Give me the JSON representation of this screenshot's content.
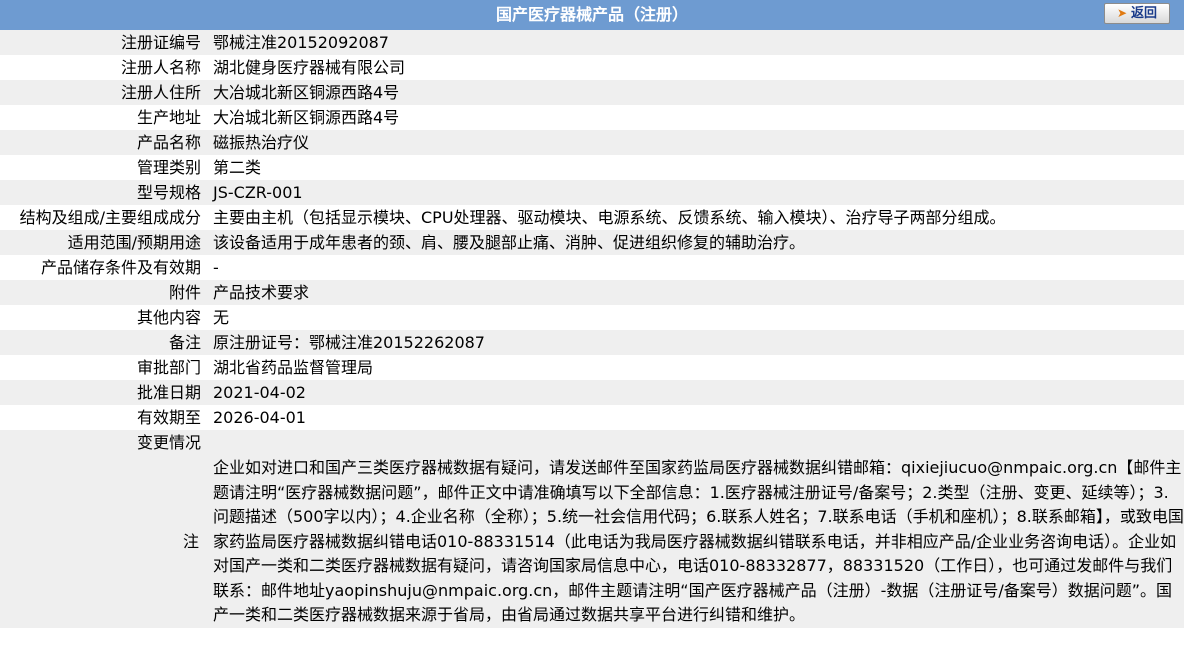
{
  "header": {
    "title": "国产医疗器械产品（注册）",
    "back_label": "返回"
  },
  "rows": [
    {
      "label": "注册证编号",
      "value": "鄂械注准20152092087"
    },
    {
      "label": "注册人名称",
      "value": "湖北健身医疗器械有限公司"
    },
    {
      "label": "注册人住所",
      "value": "大冶城北新区铜源西路4号"
    },
    {
      "label": "生产地址",
      "value": "大冶城北新区铜源西路4号"
    },
    {
      "label": "产品名称",
      "value": "磁振热治疗仪"
    },
    {
      "label": "管理类别",
      "value": "第二类"
    },
    {
      "label": "型号规格",
      "value": "JS-CZR-001"
    },
    {
      "label": "结构及组成/主要组成成分",
      "value": "主要由主机（包括显示模块、CPU处理器、驱动模块、电源系统、反馈系统、输入模块）、治疗导子两部分组成。"
    },
    {
      "label": "适用范围/预期用途",
      "value": "该设备适用于成年患者的颈、肩、腰及腿部止痛、消肿、促进组织修复的辅助治疗。"
    },
    {
      "label": "产品储存条件及有效期",
      "value": "-"
    },
    {
      "label": "附件",
      "value": "产品技术要求"
    },
    {
      "label": "其他内容",
      "value": "无"
    },
    {
      "label": "备注",
      "value": "原注册证号：鄂械注准20152262087"
    },
    {
      "label": "审批部门",
      "value": "湖北省药品监督管理局"
    },
    {
      "label": "批准日期",
      "value": "2021-04-02"
    },
    {
      "label": "有效期至",
      "value": "2026-04-01"
    },
    {
      "label": "变更情况",
      "value": ""
    }
  ],
  "note": {
    "label": "注",
    "text": "企业如对进口和国产三类医疗器械数据有疑问，请发送邮件至国家药监局医疗器械数据纠错邮箱：qixiejiucuo@nmpaic.org.cn【邮件主题请注明“医疗器械数据问题”，邮件正文中请准确填写以下全部信息：1.医疗器械注册证号/备案号；2.类型（注册、变更、延续等）；3.问题描述（500字以内）；4.企业名称（全称）；5.统一社会信用代码；6.联系人姓名；7.联系电话（手机和座机）；8.联系邮箱】，或致电国家药监局医疗器械数据纠错电话010-88331514（此电话为我局医疗器械数据纠错联系电话，并非相应产品/企业业务咨询电话）。企业如对国产一类和二类医疗器械数据有疑问，请咨询国家局信息中心，电话010-88332877，88331520（工作日），也可通过发邮件与我们联系：邮件地址yaopinshuju@nmpaic.org.cn，邮件主题请注明“国产医疗器械产品（注册）-数据（注册证号/备案号）数据问题”。国产一类和二类医疗器械数据来源于省局，由省局通过数据共享平台进行纠错和维护。"
  }
}
